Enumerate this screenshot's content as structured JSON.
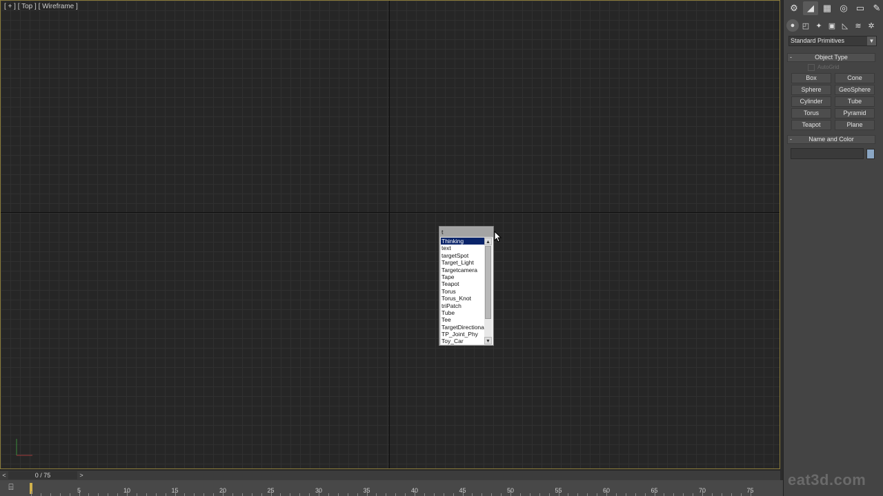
{
  "viewport": {
    "label": "[ + ] [ Top ] [ Wireframe ]"
  },
  "search_popup": {
    "input_value": "t",
    "items": [
      "Thinking",
      "text",
      "targetSpot",
      "Target_Light",
      "Targetcamera",
      "Tape",
      "Teapot",
      "Torus",
      "Torus_Knot",
      "triPatch",
      "Tube",
      "Tee",
      "TargetDirectional",
      "TP_Joint_Phy",
      "Toy_Car"
    ],
    "selected_index": 0
  },
  "command_panel": {
    "category_dropdown": "Standard Primitives",
    "object_type_rollout": {
      "title": "Object Type",
      "toggle": "-",
      "autogrid_label": "AutoGrid",
      "buttons": [
        "Box",
        "Cone",
        "Sphere",
        "GeoSphere",
        "Cylinder",
        "Tube",
        "Torus",
        "Pyramid",
        "Teapot",
        "Plane"
      ]
    },
    "name_color_rollout": {
      "title": "Name and Color",
      "toggle": "-",
      "name_value": "",
      "swatch_color": "#8aa6c4"
    }
  },
  "time_slider": {
    "frame_text": "0 / 75",
    "prev": "<",
    "next": ">"
  },
  "trackbar": {
    "labels": [
      "5",
      "10",
      "15",
      "20",
      "25",
      "30",
      "35",
      "40",
      "45",
      "50",
      "55",
      "60",
      "65",
      "70",
      "75"
    ]
  },
  "watermark": "eat3d.com"
}
